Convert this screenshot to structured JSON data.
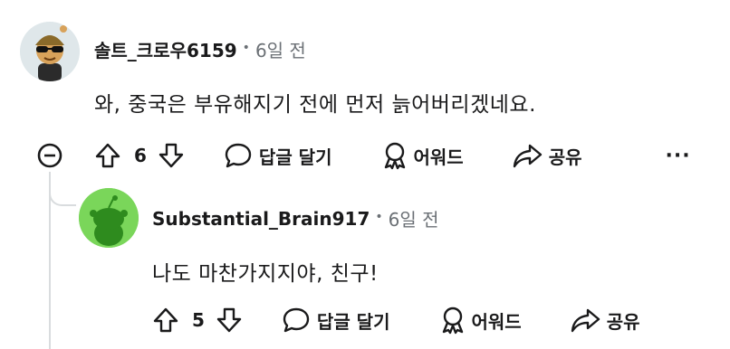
{
  "comments": [
    {
      "username": "솔트_크로우6159",
      "separator": "•",
      "time": "6일 전",
      "body": "와, 중국은 부유해지기 전에 먼저 늙어버리겠네요.",
      "votes": "6",
      "reply_label": "답글 달기",
      "award_label": "어워드",
      "share_label": "공유",
      "more_label": "···"
    },
    {
      "username": "Substantial_Brain917",
      "separator": "•",
      "time": "6일 전",
      "body": "나도 마찬가지지야, 친구!",
      "votes": "5",
      "reply_label": "답글 달기",
      "award_label": "어워드",
      "share_label": "공유"
    }
  ],
  "colors": {
    "text": "#1a1a1b",
    "meta": "#6b7075",
    "thread_line": "#d9dcde",
    "avatar2_bg": "#7ad65a",
    "avatar2_fg": "#2e8b1e"
  },
  "icons": {
    "collapse": "minus-circle-icon",
    "upvote": "arrow-up-icon",
    "downvote": "arrow-down-icon",
    "reply": "speech-bubble-icon",
    "award": "award-ribbon-icon",
    "share": "share-arrow-icon"
  }
}
